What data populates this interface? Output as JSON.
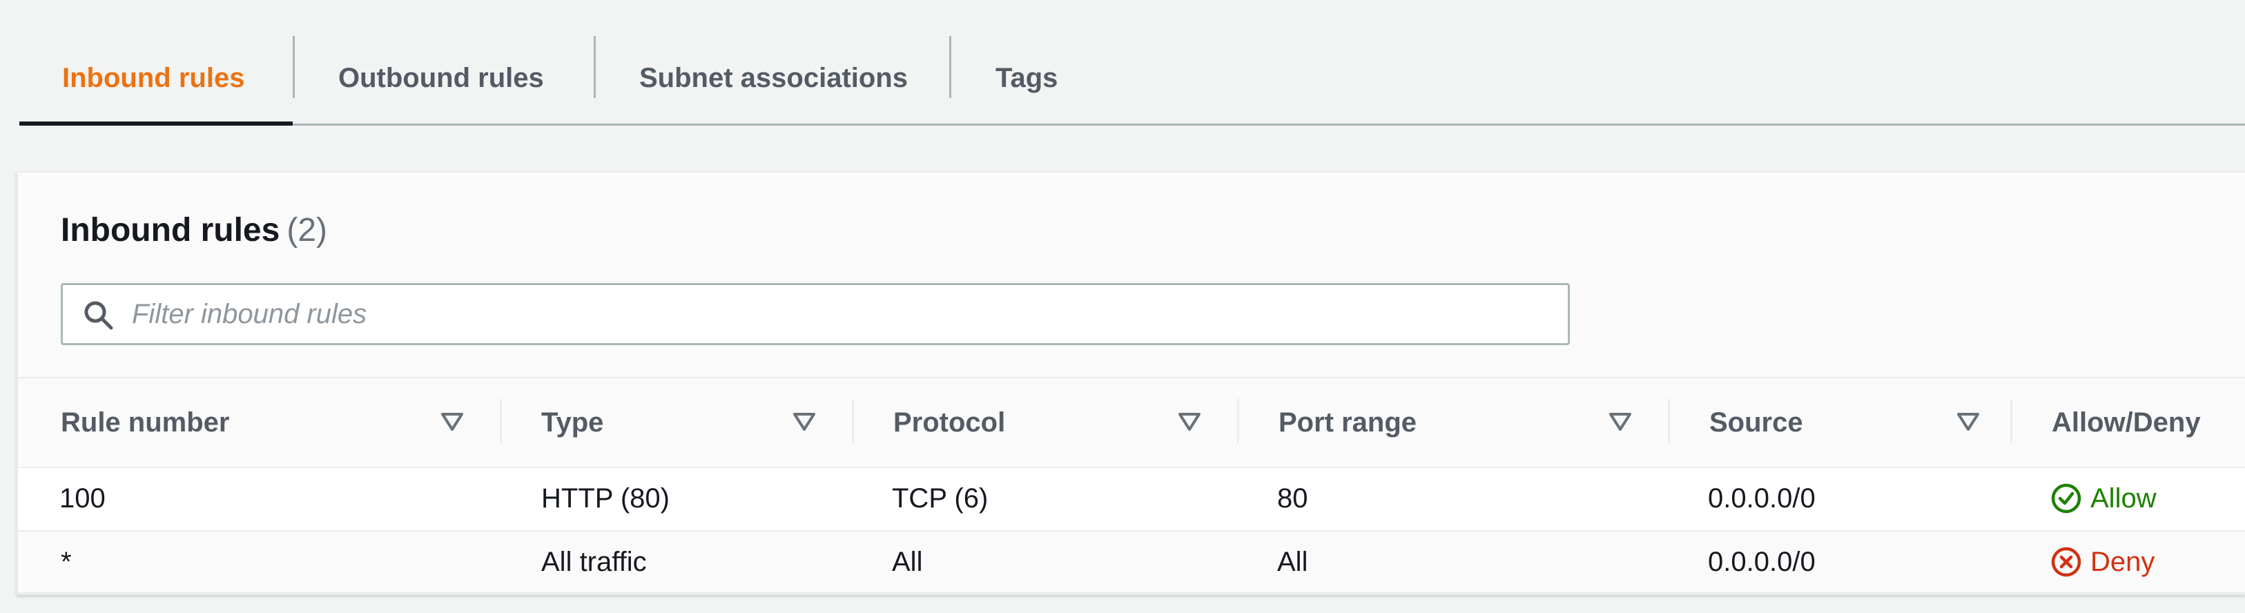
{
  "tabs": [
    {
      "label": "Inbound rules",
      "active": true
    },
    {
      "label": "Outbound rules",
      "active": false
    },
    {
      "label": "Subnet associations",
      "active": false
    },
    {
      "label": "Tags",
      "active": false
    }
  ],
  "panel": {
    "title": "Inbound rules",
    "count": "(2)"
  },
  "filter": {
    "placeholder": "Filter inbound rules",
    "value": "",
    "icon": "search-icon"
  },
  "table": {
    "columns": [
      "Rule number",
      "Type",
      "Protocol",
      "Port range",
      "Source",
      "Allow/Deny"
    ],
    "rows": [
      {
        "rule_number": "100",
        "type": "HTTP (80)",
        "protocol": "TCP (6)",
        "port_range": "80",
        "source": "0.0.0.0/0",
        "action": "Allow",
        "action_icon": "check-circle-icon"
      },
      {
        "rule_number": "*",
        "type": "All traffic",
        "protocol": "All",
        "port_range": "All",
        "source": "0.0.0.0/0",
        "action": "Deny",
        "action_icon": "x-circle-icon"
      }
    ]
  },
  "colors": {
    "accent": "#ec7211",
    "allow": "#1d8102",
    "deny": "#d13212",
    "text": "#16191f",
    "muted": "#545b64"
  }
}
